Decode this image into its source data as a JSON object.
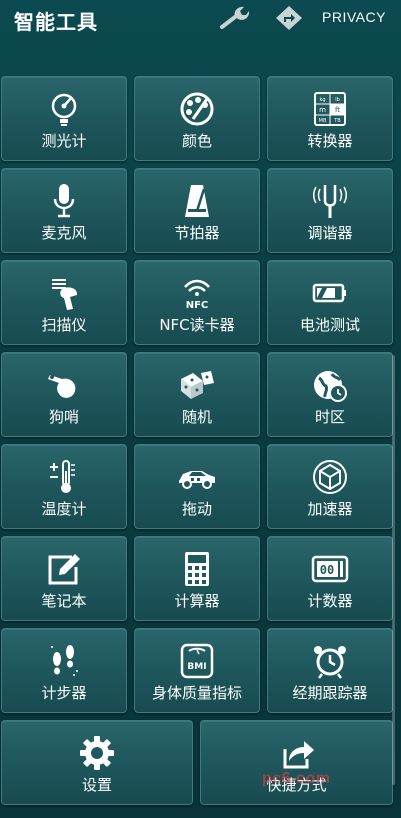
{
  "header": {
    "title": "智能工具",
    "privacy_label": "PRIVACY"
  },
  "tiles": [
    {
      "label": "测光计",
      "icon": "light-meter-icon"
    },
    {
      "label": "颜色",
      "icon": "color-picker-icon"
    },
    {
      "label": "转换器",
      "icon": "unit-converter-icon"
    },
    {
      "label": "麦克风",
      "icon": "microphone-icon"
    },
    {
      "label": "节拍器",
      "icon": "metronome-icon"
    },
    {
      "label": "调谐器",
      "icon": "tuning-fork-icon"
    },
    {
      "label": "扫描仪",
      "icon": "barcode-scanner-icon"
    },
    {
      "label": "NFC读卡器",
      "icon": "nfc-icon"
    },
    {
      "label": "电池测试",
      "icon": "battery-icon"
    },
    {
      "label": "狗哨",
      "icon": "whistle-icon"
    },
    {
      "label": "随机",
      "icon": "dice-icon"
    },
    {
      "label": "时区",
      "icon": "globe-clock-icon"
    },
    {
      "label": "温度计",
      "icon": "thermometer-icon"
    },
    {
      "label": "拖动",
      "icon": "race-car-icon"
    },
    {
      "label": "加速器",
      "icon": "accelerometer-cube-icon"
    },
    {
      "label": "笔记本",
      "icon": "notepad-pen-icon"
    },
    {
      "label": "计算器",
      "icon": "calculator-icon"
    },
    {
      "label": "计数器",
      "icon": "counter-icon"
    },
    {
      "label": "计步器",
      "icon": "footsteps-icon"
    },
    {
      "label": "身体质量指标",
      "icon": "bmi-scale-icon"
    },
    {
      "label": "经期跟踪器",
      "icon": "alarm-clock-icon"
    },
    {
      "label": "设置",
      "icon": "gear-icon"
    },
    {
      "label": "快捷方式",
      "icon": "share-shortcut-icon"
    }
  ],
  "counter_display": "00",
  "bmi_text": "BMI",
  "nfc_text": "NFC",
  "converter_units": [
    "kg",
    "lb",
    "m",
    "ft",
    "MB",
    "TB"
  ],
  "watermark": "pc6.com"
}
